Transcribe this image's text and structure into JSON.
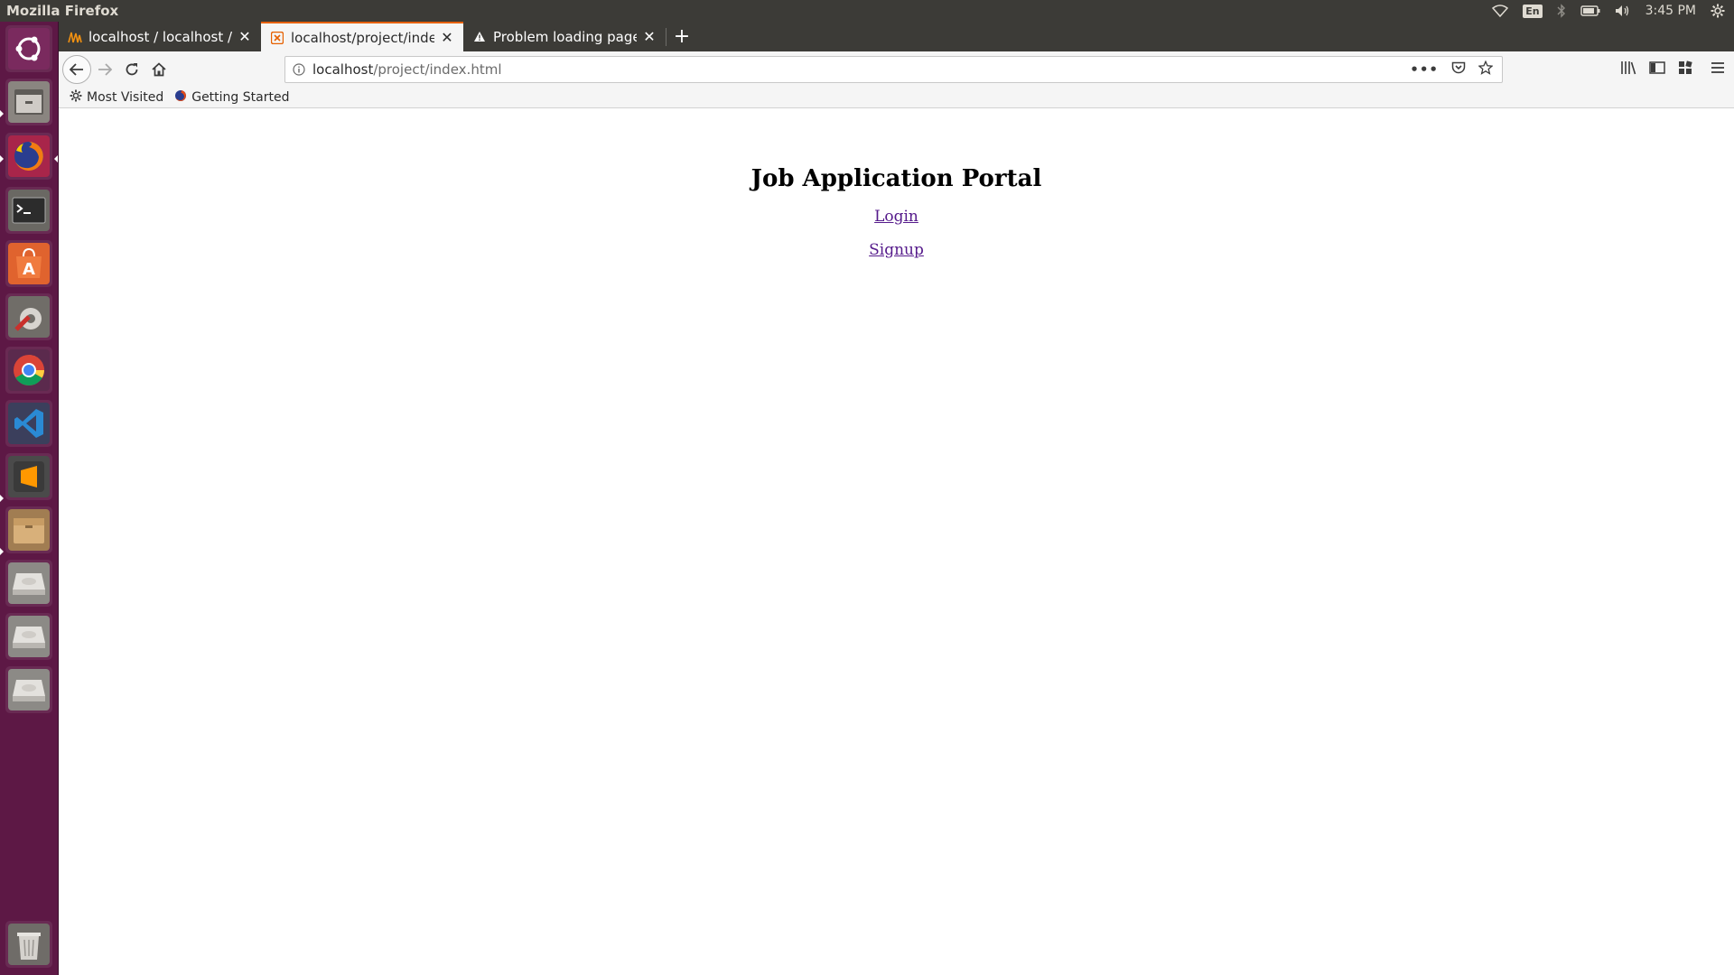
{
  "top_panel": {
    "app_title": "Mozilla Firefox",
    "keyboard_lang": "En",
    "clock": "3:45 PM"
  },
  "launcher": {
    "items": [
      {
        "name": "ubuntu-dash-icon",
        "color": "#ffffff"
      },
      {
        "name": "files-icon",
        "color": "#ffffff"
      },
      {
        "name": "firefox-icon",
        "color": "#ffffff"
      },
      {
        "name": "terminal-icon",
        "color": "#ffffff"
      },
      {
        "name": "software-center-icon",
        "color": "#ffffff"
      },
      {
        "name": "system-settings-icon",
        "color": "#ffffff"
      },
      {
        "name": "chrome-icon",
        "color": "#ffffff"
      },
      {
        "name": "vscode-icon",
        "color": "#ffffff"
      },
      {
        "name": "sublime-text-icon",
        "color": "#ffffff"
      },
      {
        "name": "archive-icon",
        "color": "#ffffff"
      },
      {
        "name": "drive-icon",
        "color": "#ffffff"
      },
      {
        "name": "drive-icon",
        "color": "#ffffff"
      },
      {
        "name": "drive-icon",
        "color": "#ffffff"
      },
      {
        "name": "trash-icon",
        "color": "#ffffff"
      }
    ]
  },
  "tabs": [
    {
      "label": "localhost / localhost / db",
      "icon": "phpmyadmin-icon",
      "active": false
    },
    {
      "label": "localhost/project/index.html",
      "icon": "xampp-icon",
      "active": true
    },
    {
      "label": "Problem loading page",
      "icon": "warning-icon",
      "active": false
    }
  ],
  "urlbar": {
    "host": "localhost",
    "path": "/project/index.html"
  },
  "bookmarks": [
    {
      "label": "Most Visited",
      "icon": "gear-icon"
    },
    {
      "label": "Getting Started",
      "icon": "firefox-icon"
    }
  ],
  "page": {
    "heading": "Job Application Portal",
    "login_link": "Login",
    "signup_link": "Signup"
  },
  "colors": {
    "launcher_bg": "#5d1845",
    "panel_bg": "#3c3b37",
    "active_tab_accent": "#e66000",
    "visited_link": "#551a8b"
  }
}
